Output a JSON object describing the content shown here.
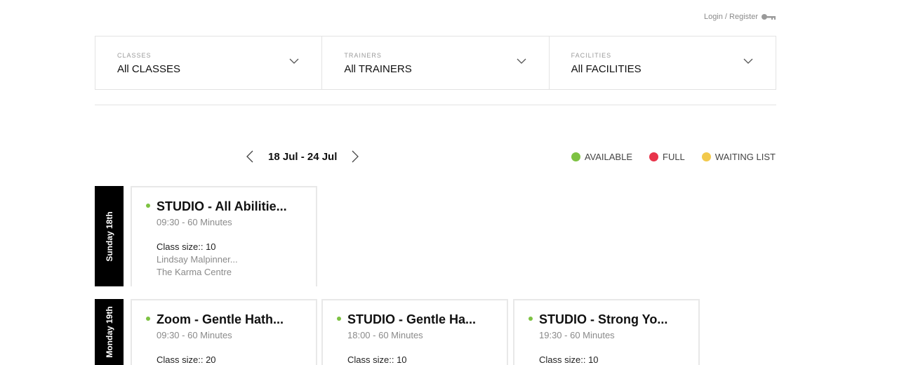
{
  "header": {
    "login_register": "Login / Register",
    "login_icon": "key-icon"
  },
  "filters": [
    {
      "label": "CLASSES",
      "value": "All CLASSES"
    },
    {
      "label": "TRAINERS",
      "value": "All TRAINERS"
    },
    {
      "label": "FACILITIES",
      "value": "All FACILITIES"
    }
  ],
  "week": {
    "range": "18 Jul - 24 Jul",
    "prev_icon": "chevron-left-icon",
    "next_icon": "chevron-right-icon"
  },
  "legend": [
    {
      "label": "AVAILABLE",
      "color": "#7dc242"
    },
    {
      "label": "FULL",
      "color": "#e8334a"
    },
    {
      "label": "WAITING LIST",
      "color": "#f2c94c"
    }
  ],
  "days": [
    {
      "label": "Sunday 18th",
      "classes": [
        {
          "title": "STUDIO - All Abilitie...",
          "time": "09:30 - 60 Minutes",
          "size": "Class size:: 10",
          "trainer": "Lindsay Malpinner...",
          "venue": "The Karma Centre",
          "status_color": "#7dc242"
        }
      ]
    },
    {
      "label": "Monday 19th",
      "classes": [
        {
          "title": "Zoom - Gentle Hath...",
          "time": "09:30 - 60 Minutes",
          "size": "Class size:: 20",
          "status_color": "#7dc242"
        },
        {
          "title": "STUDIO - Gentle Ha...",
          "time": "18:00 - 60 Minutes",
          "size": "Class size:: 10",
          "status_color": "#7dc242"
        },
        {
          "title": "STUDIO - Strong Yo...",
          "time": "19:30 - 60 Minutes",
          "size": "Class size:: 10",
          "status_color": "#7dc242"
        }
      ]
    }
  ]
}
